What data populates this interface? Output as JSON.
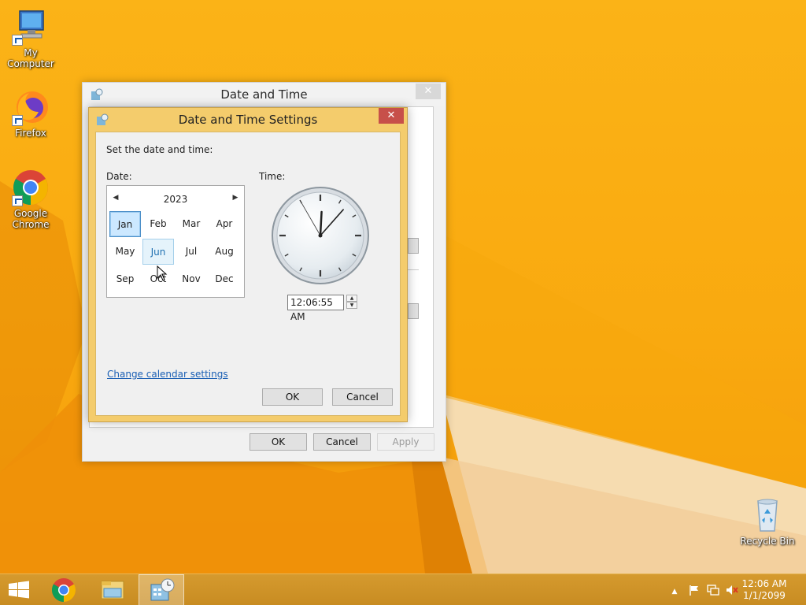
{
  "desktop": {
    "icons": [
      {
        "label": "My Computer",
        "icon": "computer-icon"
      },
      {
        "label": "Firefox",
        "icon": "firefox-icon"
      },
      {
        "label": "Google Chrome",
        "icon": "chrome-icon"
      },
      {
        "label": "Recycle Bin",
        "icon": "recycle-bin-icon"
      }
    ]
  },
  "outer_window": {
    "title": "Date and Time",
    "close_glyph": "✕",
    "buttons": {
      "ok": "OK",
      "cancel": "Cancel",
      "apply": "Apply"
    }
  },
  "dialog": {
    "title": "Date and Time Settings",
    "close_glyph": "✕",
    "instruction": "Set the date and time:",
    "date_label": "Date:",
    "time_label": "Time:",
    "calendar": {
      "year": "2023",
      "prev_glyph": "◀",
      "next_glyph": "▶",
      "months": [
        "Jan",
        "Feb",
        "Mar",
        "Apr",
        "May",
        "Jun",
        "Jul",
        "Aug",
        "Sep",
        "Oct",
        "Nov",
        "Dec"
      ],
      "selected_month": "Jan",
      "hovered_month": "Jun"
    },
    "clock": {
      "hour": 12,
      "minute": 6,
      "second": 55
    },
    "time_value": "12:06:55 AM",
    "spin_up": "▲",
    "spin_down": "▼",
    "change_calendar_link": "Change calendar settings",
    "ok": "OK",
    "cancel": "Cancel"
  },
  "taskbar": {
    "start_icon": "windows-start-icon",
    "pinned": [
      {
        "name": "chrome-icon",
        "active": false
      },
      {
        "name": "file-explorer-icon",
        "active": false
      },
      {
        "name": "date-time-control-panel-icon",
        "active": true
      }
    ],
    "tray": {
      "show_hidden_glyph": "▲",
      "icons": [
        "action-center-flag-icon",
        "network-icon",
        "volume-muted-icon"
      ],
      "time": "12:06 AM",
      "date": "1/1/2099"
    }
  },
  "colors": {
    "wallpaper": "#fbb317",
    "dialog_frame": "#f4cc6c",
    "dialog_close": "#c7504a",
    "link": "#1a5fb4",
    "taskbar": "#d59a2e"
  }
}
